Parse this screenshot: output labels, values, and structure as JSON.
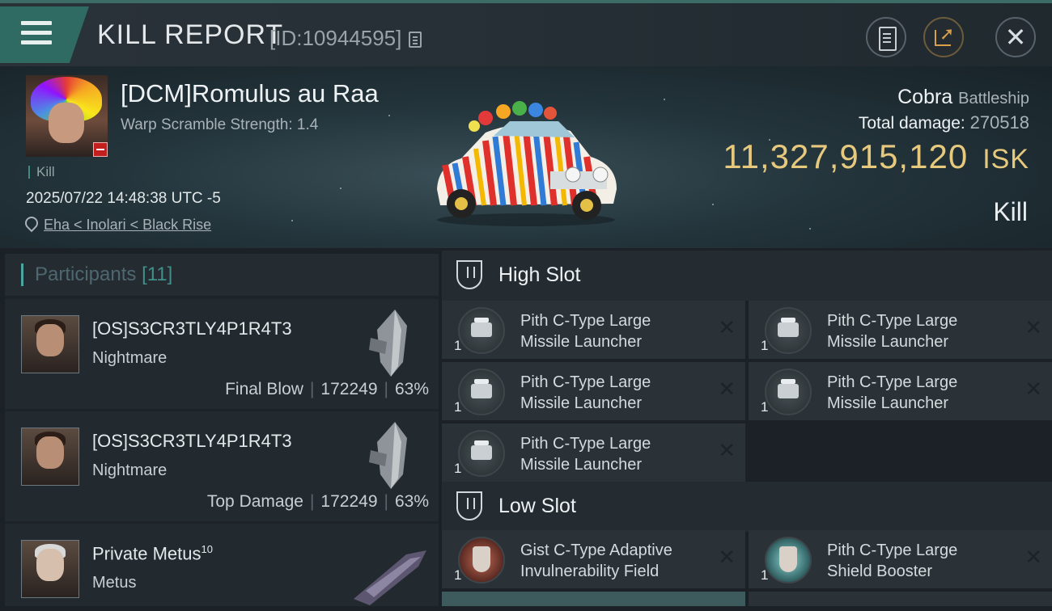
{
  "header": {
    "title": "KILL REPORT",
    "report_id": "[ID:10944595]"
  },
  "victim": {
    "name": "[DCM]Romulus au Raa",
    "warp_scramble": "Warp Scramble Strength: 1.4",
    "kill_tag": "Kill",
    "datetime": "2025/07/22 14:48:38 UTC -5",
    "location": "Eha < Inolari < Black Rise",
    "ship_name": "Cobra",
    "ship_class": "Battleship",
    "total_damage_label": "Total damage:",
    "total_damage": "270518",
    "isk_value": "11,327,915,120",
    "isk_unit": "ISK",
    "result": "Kill"
  },
  "participants": {
    "title": "Participants",
    "count": "[11]",
    "rows": [
      {
        "name": "[OS]S3CR3TLY4P1R4T3",
        "ship": "Nightmare",
        "role": "Final Blow",
        "damage": "172249",
        "percent": "63%"
      },
      {
        "name": "[OS]S3CR3TLY4P1R4T3",
        "ship": "Nightmare",
        "role": "Top Damage",
        "damage": "172249",
        "percent": "63%"
      },
      {
        "name": "Private Metus",
        "level": "10",
        "ship": "Metus"
      }
    ]
  },
  "slots": {
    "high": {
      "title": "High Slot",
      "modules": [
        {
          "line1": "Pith C-Type Large",
          "line2": "Missile Launcher",
          "qty": "1"
        },
        {
          "line1": "Pith C-Type Large",
          "line2": "Missile Launcher",
          "qty": "1"
        },
        {
          "line1": "Pith C-Type Large",
          "line2": "Missile Launcher",
          "qty": "1"
        },
        {
          "line1": "Pith C-Type Large",
          "line2": "Missile Launcher",
          "qty": "1"
        },
        {
          "line1": "Pith C-Type Large",
          "line2": "Missile Launcher",
          "qty": "1"
        }
      ]
    },
    "low": {
      "title": "Low Slot",
      "modules": [
        {
          "line1": "Gist C-Type Adaptive",
          "line2": "Invulnerability Field",
          "qty": "1"
        },
        {
          "line1": "Pith C-Type Large",
          "line2": "Shield Booster",
          "qty": "1"
        }
      ]
    }
  },
  "colors": {
    "accent_teal": "#2f6a63",
    "isk_gold": "#e7c97e",
    "remove_badge": "#c41f1f"
  },
  "icons": [
    "menu-icon",
    "copy-icon",
    "clipboard-icon",
    "share-icon",
    "close-icon",
    "location-pin-icon",
    "slot-shield-icon",
    "close-x-icon"
  ]
}
